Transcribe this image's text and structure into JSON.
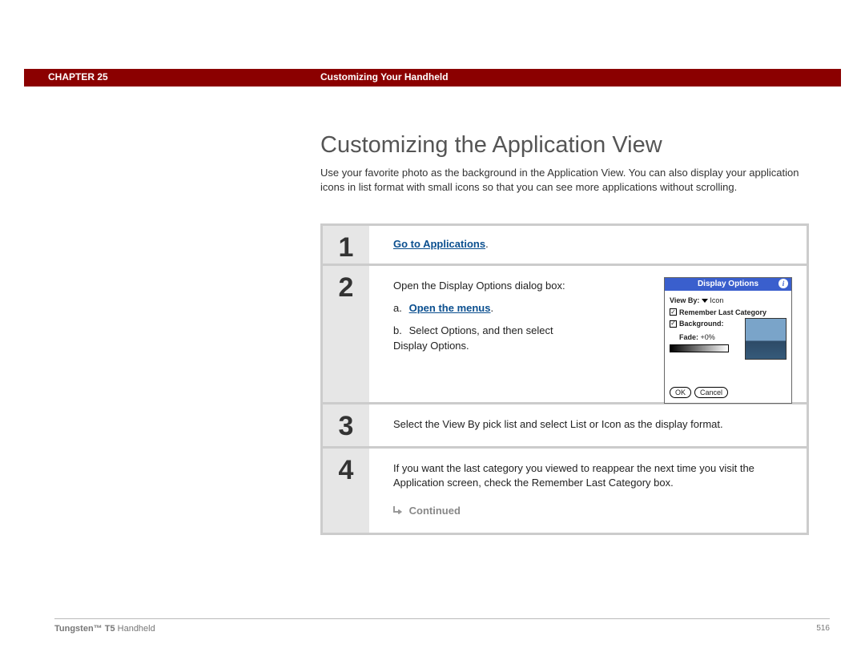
{
  "header": {
    "chapter_label": "CHAPTER 25",
    "section_title": "Customizing Your Handheld"
  },
  "title": "Customizing the Application View",
  "intro": "Use your favorite photo as the background in the Application View. You can also display your application icons in list format with small icons so that you can see more applications without scrolling.",
  "steps": {
    "s1": {
      "num": "1",
      "link_text": "Go to Applications",
      "after": "."
    },
    "s2": {
      "num": "2",
      "lead": "Open the Display Options dialog box:",
      "a_label": "a.",
      "a_link": "Open the menus",
      "a_after": ".",
      "b_label": "b.",
      "b_text": "Select Options, and then select Display Options."
    },
    "s3": {
      "num": "3",
      "text": "Select the View By pick list and select List or Icon as the display format."
    },
    "s4": {
      "num": "4",
      "text": "If you want the last category you viewed to reappear the next time you visit the Application screen, check the Remember Last Category box.",
      "continued": "Continued"
    }
  },
  "dialog": {
    "title": "Display Options",
    "viewby_label": "View By:",
    "viewby_value": "Icon",
    "remember_label": "Remember Last Category",
    "background_label": "Background:",
    "fade_label": "Fade:",
    "fade_value": "+0%",
    "ok": "OK",
    "cancel": "Cancel"
  },
  "footer": {
    "product_bold": "Tungsten™ T5",
    "product_rest": " Handheld",
    "page": "516"
  }
}
